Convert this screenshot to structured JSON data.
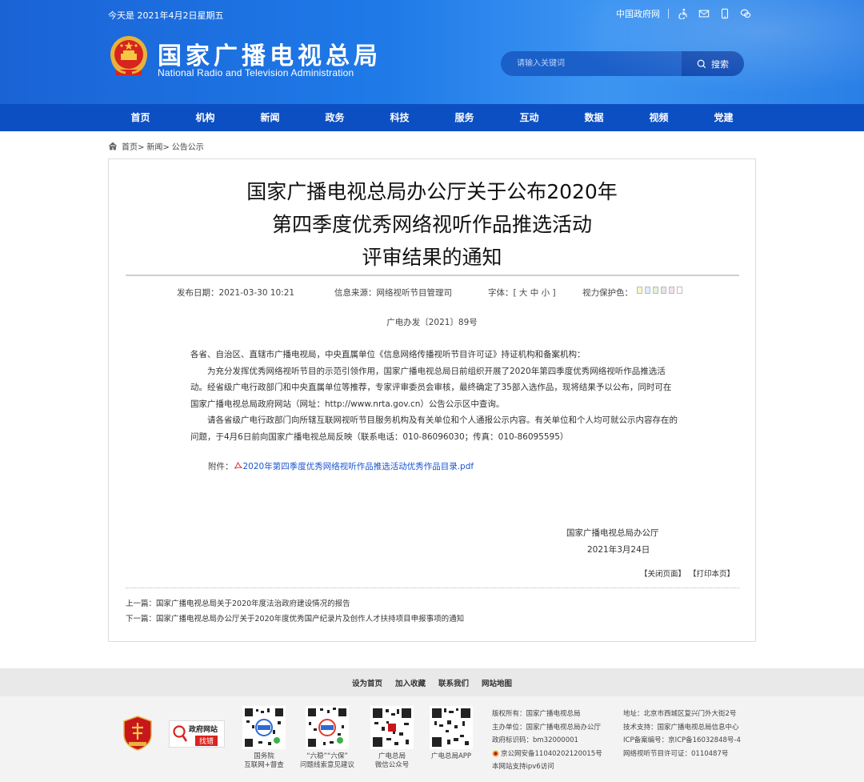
{
  "header": {
    "date_text": "今天是 2021年4月2日星期五",
    "gov_link": "中国政府网",
    "site_name_cn": "国家广播电视总局",
    "site_name_en": "National Radio and Television Administration",
    "search_placeholder": "请输入关键词",
    "search_button": "搜索",
    "top_icons": [
      "accessibility-icon",
      "mail-icon",
      "mobile-icon",
      "wechat-icon"
    ]
  },
  "nav": {
    "items": [
      "首页",
      "机构",
      "新闻",
      "政务",
      "科技",
      "服务",
      "互动",
      "数据",
      "视频",
      "党建"
    ]
  },
  "breadcrumb": {
    "items": [
      "首页>",
      "新闻>",
      "公告公示"
    ]
  },
  "article": {
    "title_lines": [
      "国家广播电视总局办公厅关于公布2020年",
      "第四季度优秀网络视听作品推选活动",
      "评审结果的通知"
    ],
    "meta": {
      "publish_date": "发布日期：2021-03-30 10:21",
      "source": "信息来源：网络视听节目管理司",
      "font_size": "字体：[ 大 中 小 ]",
      "eye_color": "视力保护色：",
      "swatch_colors": [
        "#fbf6c4",
        "#dbeffb",
        "#e0f3dc",
        "#e5e5e5",
        "#f4dff1",
        "#ffffff"
      ]
    },
    "doc_no": "广电办发〔2021〕89号",
    "para1": "各省、自治区、直辖市广播电视局，中央直属单位《信息网络传播视听节目许可证》持证机构和备案机构：",
    "para2": "为充分发挥优秀网络视听节目的示范引领作用，国家广播电视总局日前组织开展了2020年第四季度优秀网络视听作品推选活动。经省级广电行政部门和中央直属单位等推荐，专家评审委员会审核，最终确定了35部入选作品，现将结果予以公布，同时可在国家广播电视总局政府网站（网址：http://www.nrta.gov.cn）公告公示区中查询。",
    "para3": "请各省级广电行政部门向所辖互联网视听节目服务机构及有关单位和个人通报公示内容。有关单位和个人均可就公示内容存在的问题，于4月6日前向国家广播电视总局反映（联系电话：010-86096030；传真：010-86095595）",
    "attachment_label": "附件：",
    "attachment_link": "2020年第四季度优秀网络视听作品推选活动优秀作品目录.pdf",
    "sign_org": "国家广播电视总局办公厅",
    "sign_date": "2021年3月24日",
    "close_page": "【关闭页面】",
    "print_page": "【打印本页】",
    "prev": "上一篇：国家广播电视总局关于2020年度法治政府建设情况的报告",
    "next": "下一篇：国家广播电视总局办公厅关于2020年度优秀国产纪录片及创作人才扶持项目申报事项的通知"
  },
  "footer": {
    "links": [
      "设为首页",
      "加入收藏",
      "联系我们",
      "网站地图"
    ],
    "badge_gov_line1": "政府网站",
    "badge_gov_line2": "找错",
    "qr_labels": [
      [
        "国务院",
        "互联网+督查"
      ],
      [
        "“六稳”“六保”",
        "问题线索意见建议"
      ],
      [
        "广电总局",
        "微信公众号"
      ],
      [
        "广电总局APP",
        ""
      ]
    ],
    "info_left": [
      "版权所有：国家广播电视总局",
      "主办单位：国家广播电视总局办公厅",
      "政府标识码：bm32000001",
      "京公网安备11040202120015号",
      "本网站支持ipv6访问"
    ],
    "info_right": [
      "地址：北京市西城区复兴门外大街2号",
      "技术支持：国家广播电视总局信息中心",
      "ICP备案编号：京ICP备16032848号-4",
      "网络视听节目许可证：0110487号"
    ]
  }
}
